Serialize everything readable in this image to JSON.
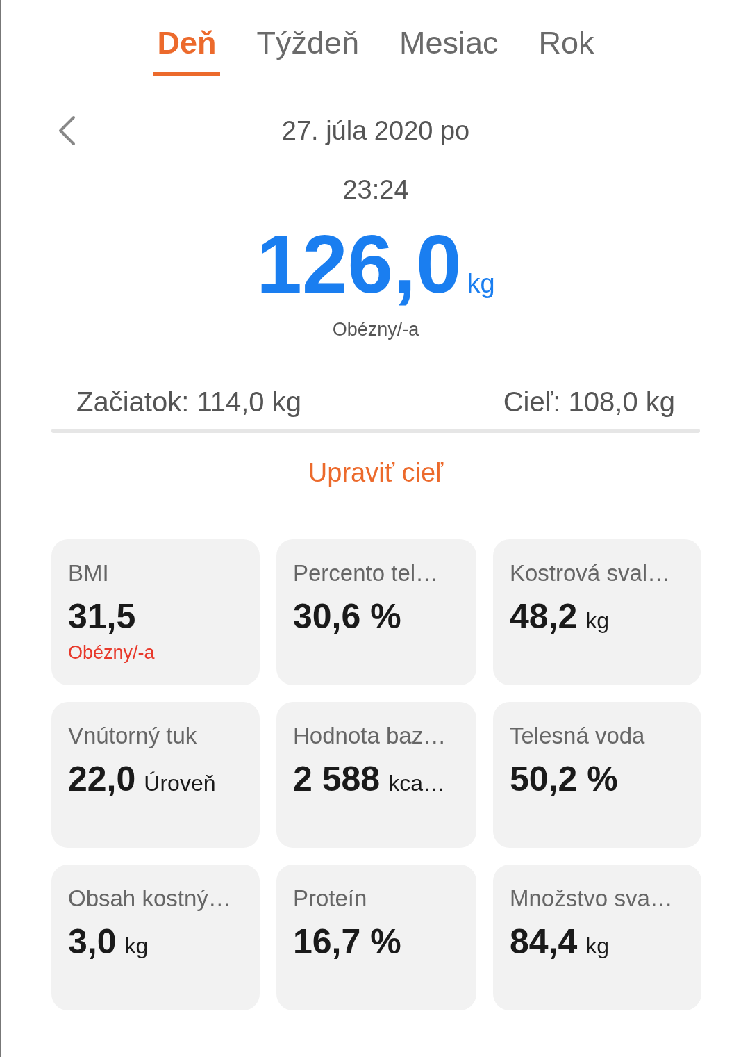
{
  "tabs": [
    {
      "label": "Deň",
      "selected": true
    },
    {
      "label": "Týždeň",
      "selected": false
    },
    {
      "label": "Mesiac",
      "selected": false
    },
    {
      "label": "Rok",
      "selected": false
    }
  ],
  "date": "27. júla 2020 po",
  "time": "23:24",
  "weight": {
    "value": "126,0",
    "unit": "kg",
    "status": "Obézny/-a"
  },
  "goal": {
    "start": "Začiatok: 114,0 kg",
    "target": "Cieľ: 108,0 kg",
    "level": 0,
    "edit_link": "Upraviť cieľ"
  },
  "metrics": [
    {
      "label": "BMI",
      "value": "31,5",
      "status": "Obézny/-a"
    },
    {
      "label": "Percento tel…",
      "value": "30,6 %"
    },
    {
      "label": "Kostrová sval…",
      "value": "48,2",
      "unit": "kg"
    },
    {
      "label": "Vnútorný tuk",
      "value": "22,0",
      "unit": "Úroveň"
    },
    {
      "label": "Hodnota baz…",
      "value": "2 588",
      "unit": "kca…"
    },
    {
      "label": "Telesná voda",
      "value": "50,2 %"
    },
    {
      "label": "Obsah kostný…",
      "value": "3,0",
      "unit": "kg"
    },
    {
      "label": "Proteín",
      "value": "16,7 %"
    },
    {
      "label": "Množstvo sva…",
      "value": "84,4",
      "unit": "kg"
    }
  ]
}
